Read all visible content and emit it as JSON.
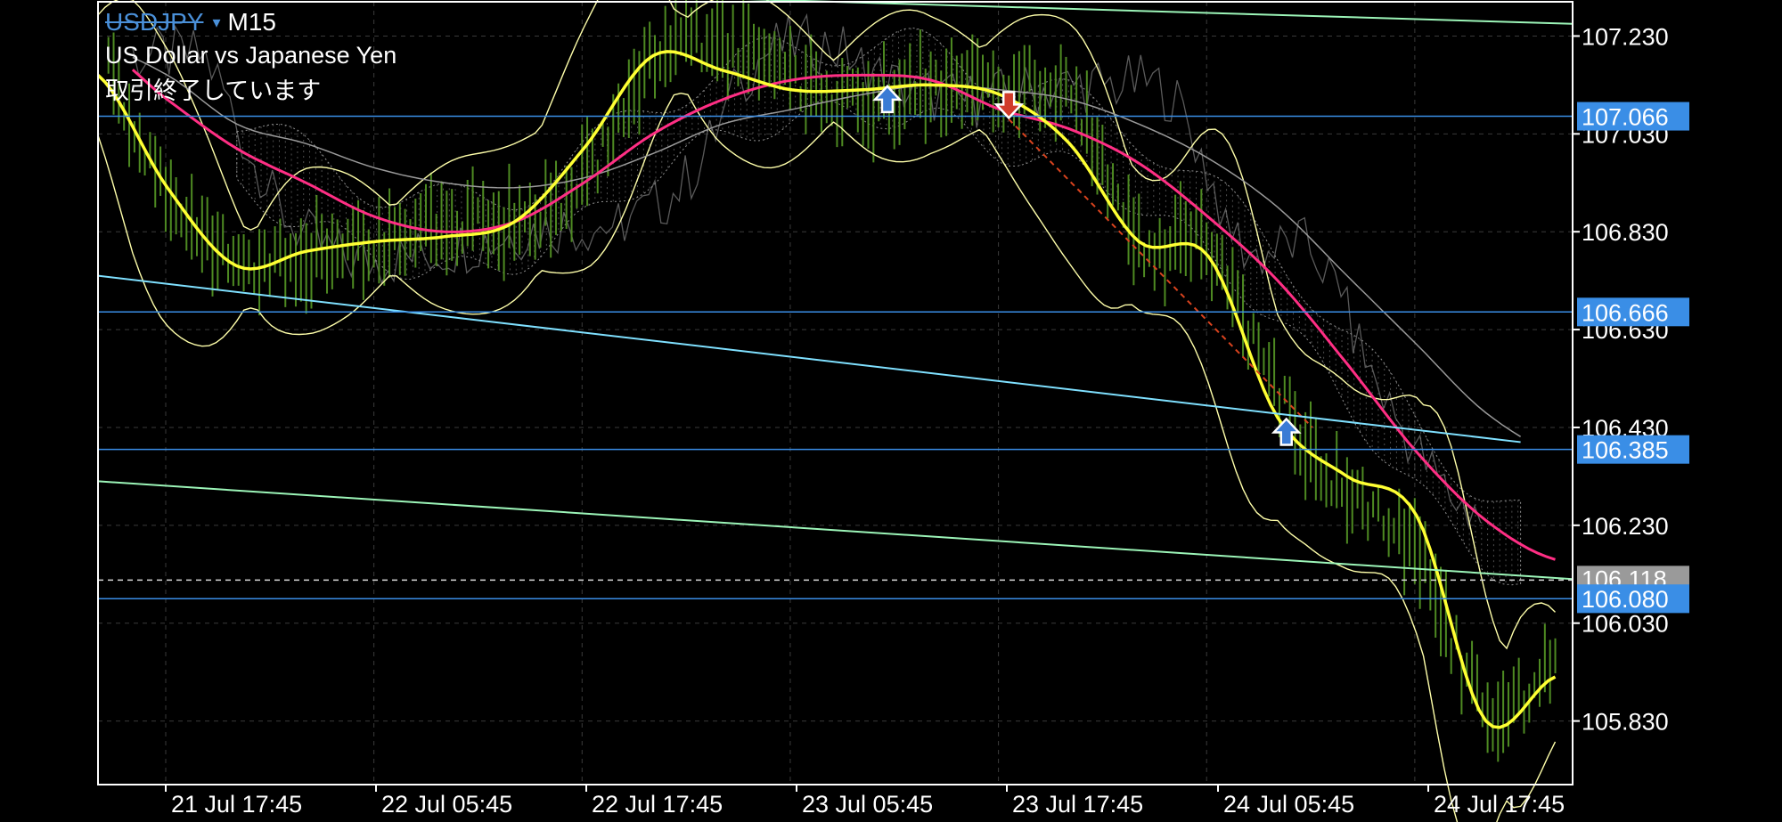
{
  "header": {
    "symbol": "USDJPY",
    "dropdown_icon": "▾",
    "timeframe": "M15",
    "description": "US Dollar vs Japanese Yen",
    "status": "取引終了しています"
  },
  "colors": {
    "background": "#000000",
    "frame": "#ffffff",
    "grid": "#3a3a3a",
    "candle": "#4e8a22",
    "ma_fast": "#ffff33",
    "ma_slow": "#ff2e84",
    "ma_long": "#9a9a9a",
    "bollinger": "#ffffaa",
    "cloud": "#8f8f8f",
    "lagging": "#5a5a5a",
    "channel": "#7fe0ff",
    "channel_green": "#9cf5b8",
    "h_line": "#3a8ee6",
    "price_label_bg": "#3a8ee6",
    "current_label_bg": "#9a9a9a",
    "arrow_buy": "#3a7bd5",
    "arrow_sell": "#d13b2a",
    "trend_dash": "#d9431e"
  },
  "chart_data": {
    "type": "candlestick",
    "symbol": "USDJPY",
    "timeframe": "M15",
    "ylim": [
      105.7,
      107.3
    ],
    "price_ticks": [
      "107.230",
      "107.030",
      "106.830",
      "106.630",
      "106.430",
      "106.230",
      "106.030",
      "105.830"
    ],
    "time_ticks": [
      "21 Jul 17:45",
      "22 Jul 05:45",
      "22 Jul 17:45",
      "23 Jul 05:45",
      "23 Jul 17:45",
      "24 Jul 05:45",
      "24 Jul 17:45"
    ],
    "x": [
      0,
      4,
      8,
      12,
      16,
      20,
      24,
      28,
      32,
      36,
      40,
      44,
      48,
      52,
      56,
      60,
      64,
      68,
      72,
      76,
      80,
      84
    ],
    "horizontal_lines": [
      {
        "price": 107.066,
        "label": "107.066"
      },
      {
        "price": 106.666,
        "label": "106.666"
      },
      {
        "price": 106.385,
        "label": "106.385"
      },
      {
        "price": 106.08,
        "label": "106.080"
      }
    ],
    "current_price": {
      "price": 106.118,
      "label": "106.118"
    },
    "series": [
      {
        "kind": "close",
        "values": [
          107.19,
          106.9,
          106.78,
          106.78,
          106.81,
          106.84,
          106.85,
          106.94,
          107.18,
          107.21,
          107.13,
          107.1,
          107.12,
          107.13,
          107.1,
          106.8,
          106.79,
          106.5,
          106.29,
          106.18,
          105.85,
          105.95
        ]
      },
      {
        "kind": "ma_fast",
        "values": [
          107.15,
          106.92,
          106.76,
          106.79,
          106.81,
          106.82,
          106.85,
          107.0,
          107.19,
          107.16,
          107.12,
          107.12,
          107.13,
          107.11,
          107.01,
          106.81,
          106.78,
          106.45,
          106.33,
          106.25,
          105.83,
          105.92
        ]
      },
      {
        "kind": "ma_slow",
        "values": [
          107.21,
          107.1,
          107.0,
          106.93,
          106.86,
          106.83,
          106.85,
          106.93,
          107.03,
          107.1,
          107.14,
          107.15,
          107.14,
          107.08,
          107.04,
          106.97,
          106.86,
          106.73,
          106.56,
          106.38,
          106.24,
          106.16
        ]
      },
      {
        "kind": "ma_long",
        "values": [
          107.21,
          107.15,
          107.05,
          107.01,
          106.96,
          106.93,
          106.92,
          106.94,
          106.99,
          107.05,
          107.08,
          107.11,
          107.13,
          107.12,
          107.1,
          107.05,
          106.98,
          106.88,
          106.74,
          106.6,
          106.46,
          106.38
        ]
      }
    ],
    "signals": [
      {
        "x": 45.5,
        "price": 107.1,
        "type": "buy"
      },
      {
        "x": 52.5,
        "price": 107.09,
        "type": "sell"
      },
      {
        "x": 68.5,
        "price": 106.42,
        "type": "buy"
      }
    ]
  }
}
